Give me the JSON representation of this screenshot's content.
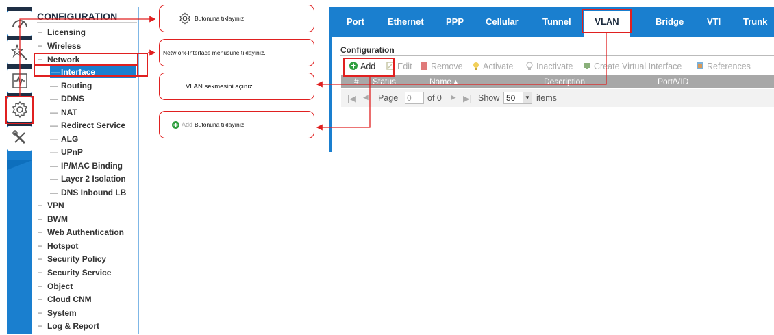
{
  "iconbar": {
    "icons": [
      "dashboard-icon",
      "wizard-icon",
      "monitor-icon",
      "configuration-gear-icon",
      "maintenance-tools-icon"
    ]
  },
  "nav": {
    "title": "CONFIGURATION",
    "items": [
      {
        "marker": "+",
        "label": "Licensing"
      },
      {
        "marker": "+",
        "label": "Wireless"
      },
      {
        "marker": "−",
        "label": "Network"
      },
      {
        "marker": "+",
        "label": "VPN"
      },
      {
        "marker": "+",
        "label": "BWM"
      },
      {
        "marker": "−",
        "label": "Web Authentication"
      },
      {
        "marker": "+",
        "label": "Hotspot"
      },
      {
        "marker": "+",
        "label": "Security Policy"
      },
      {
        "marker": "+",
        "label": "Security Service"
      },
      {
        "marker": "+",
        "label": "Object"
      },
      {
        "marker": "+",
        "label": "Cloud CNM"
      },
      {
        "marker": "+",
        "label": "System"
      },
      {
        "marker": "+",
        "label": "Log & Report"
      }
    ],
    "network_children": [
      {
        "marker": "—",
        "label": "Interface"
      },
      {
        "marker": "—",
        "label": "Routing"
      },
      {
        "marker": "—",
        "label": "DDNS"
      },
      {
        "marker": "—",
        "label": "NAT"
      },
      {
        "marker": "—",
        "label": "Redirect Service"
      },
      {
        "marker": "—",
        "label": "ALG"
      },
      {
        "marker": "—",
        "label": "UPnP"
      },
      {
        "marker": "—",
        "label": "IP/MAC Binding"
      },
      {
        "marker": "—",
        "label": "Layer 2 Isolation"
      },
      {
        "marker": "—",
        "label": "DNS Inbound LB"
      }
    ]
  },
  "callouts": {
    "c1": "Butonuna tıklayınız.",
    "c2": "Netw ork-Interface menüsüne tıklayınız.",
    "c3": "VLAN sekmesini açınız.",
    "c4_add": "Add",
    "c4": "Butonuna tıklayınız."
  },
  "tabs": [
    "Port",
    "Ethernet",
    "PPP",
    "Cellular",
    "Tunnel",
    "VLAN",
    "Bridge",
    "VTI",
    "Trunk"
  ],
  "active_tab": "VLAN",
  "section_title": "Configuration",
  "toolbar": {
    "add": "Add",
    "edit": "Edit",
    "remove": "Remove",
    "activate": "Activate",
    "inactivate": "Inactivate",
    "create_virtual": "Create Virtual Interface",
    "references": "References"
  },
  "table": {
    "columns": [
      "#",
      "Status",
      "Name ▴",
      "Description",
      "Port/VID"
    ]
  },
  "pager": {
    "page_label": "Page",
    "page_value": "0",
    "of_label": "of 0",
    "show_label": "Show",
    "show_value": "50",
    "items_label": "items"
  },
  "colors": {
    "accent": "#1a7fcf",
    "annotation": "#e02020",
    "add_green": "#2e9e3e"
  }
}
